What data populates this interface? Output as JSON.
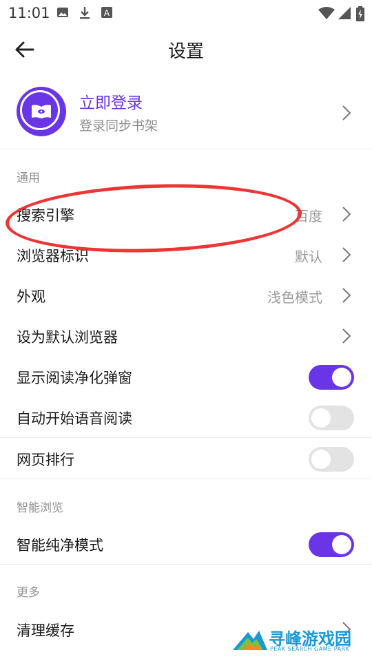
{
  "status_bar": {
    "time": "11:01"
  },
  "app_bar": {
    "title": "设置"
  },
  "profile": {
    "title": "立即登录",
    "subtitle": "登录同步书架"
  },
  "sections": {
    "general": "通用",
    "smart_browse": "智能浏览",
    "more": "更多"
  },
  "rows": {
    "search_engine": {
      "label": "搜索引擎",
      "value": "百度"
    },
    "browser_ua": {
      "label": "浏览器标识",
      "value": "默认"
    },
    "appearance": {
      "label": "外观",
      "value": "浅色模式"
    },
    "default_browser": {
      "label": "设为默认浏览器"
    },
    "reader_popup": {
      "label": "显示阅读净化弹窗",
      "on": true
    },
    "auto_tts": {
      "label": "自动开始语音阅读",
      "on": false
    },
    "web_rank": {
      "label": "网页排行",
      "on": false
    },
    "smart_pure": {
      "label": "智能纯净模式",
      "on": true
    },
    "clear_cache": {
      "label": "清理缓存"
    }
  },
  "watermark": {
    "title": "寻峰游戏园",
    "subtitle": "PEAK SEARCH GAME PARK"
  },
  "colors": {
    "accent": "#6a35e6",
    "annotation": "#ee3434",
    "watermark": "#1a98d5"
  }
}
